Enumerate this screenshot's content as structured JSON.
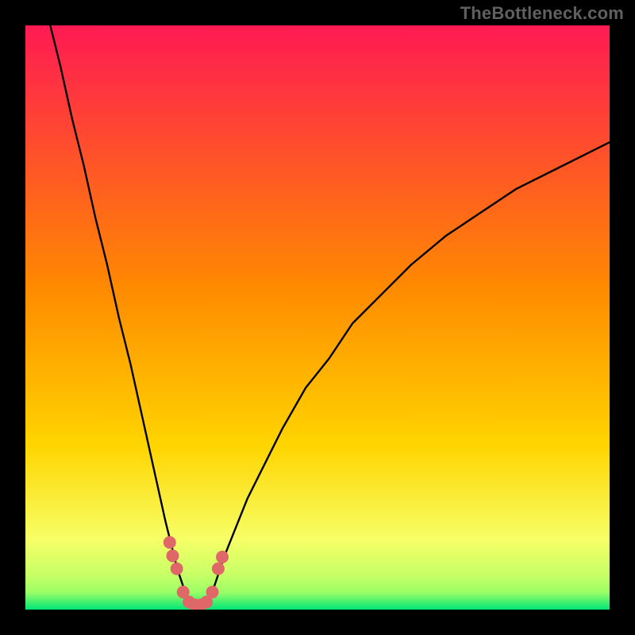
{
  "watermark": "TheBottleneck.com",
  "colors": {
    "frame_bg": "#000000",
    "grad_top": "#ff1a53",
    "grad_mid": "#ffd500",
    "grad_lower": "#f7ff66",
    "grad_bottom_high": "#9cff66",
    "grad_bottom": "#00e676",
    "curve": "#000000",
    "marker_fill": "#e06767",
    "marker_stroke": "#c24b4b"
  },
  "chart_data": {
    "type": "line",
    "title": "",
    "xlabel": "",
    "ylabel": "",
    "xlim": [
      0,
      100
    ],
    "ylim": [
      0,
      100
    ],
    "notch_x": 29,
    "series": [
      {
        "name": "bottleneck-curve",
        "x": [
          0,
          2,
          4,
          6,
          8,
          10,
          12,
          14,
          16,
          18,
          20,
          22,
          24,
          25,
          26,
          27,
          28,
          29,
          30,
          31,
          32,
          33,
          34,
          36,
          38,
          40,
          44,
          48,
          52,
          56,
          60,
          66,
          72,
          78,
          84,
          90,
          96,
          100
        ],
        "y": [
          118,
          110,
          101,
          93,
          84,
          76,
          67,
          59,
          50,
          42,
          33,
          24,
          15,
          11,
          7,
          4,
          1.5,
          0.5,
          0.5,
          1.5,
          3,
          6,
          9,
          14,
          19,
          23,
          31,
          38,
          43,
          49,
          53,
          59,
          64,
          68,
          72,
          75,
          78,
          80
        ]
      }
    ],
    "markers": {
      "name": "highlighted-points",
      "x": [
        24.7,
        25.2,
        25.9,
        27.0,
        28.0,
        29.0,
        30.0,
        31.0,
        32.0,
        33.0,
        33.7
      ],
      "y": [
        11.5,
        9.2,
        7.0,
        3.0,
        1.3,
        0.8,
        0.8,
        1.3,
        3.0,
        7.0,
        9.0
      ]
    }
  }
}
